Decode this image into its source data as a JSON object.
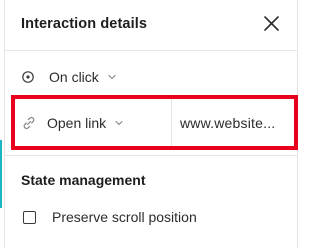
{
  "panel": {
    "title": "Interaction details",
    "close_icon": "close-icon"
  },
  "trigger": {
    "icon": "target-icon",
    "label": "On click"
  },
  "action": {
    "icon": "link-icon",
    "label": "Open link",
    "url_value": "www.website..."
  },
  "highlight_color": "#e8001c",
  "state_management": {
    "title": "State management",
    "preserve_scroll": {
      "label": "Preserve scroll position",
      "checked": false
    }
  }
}
